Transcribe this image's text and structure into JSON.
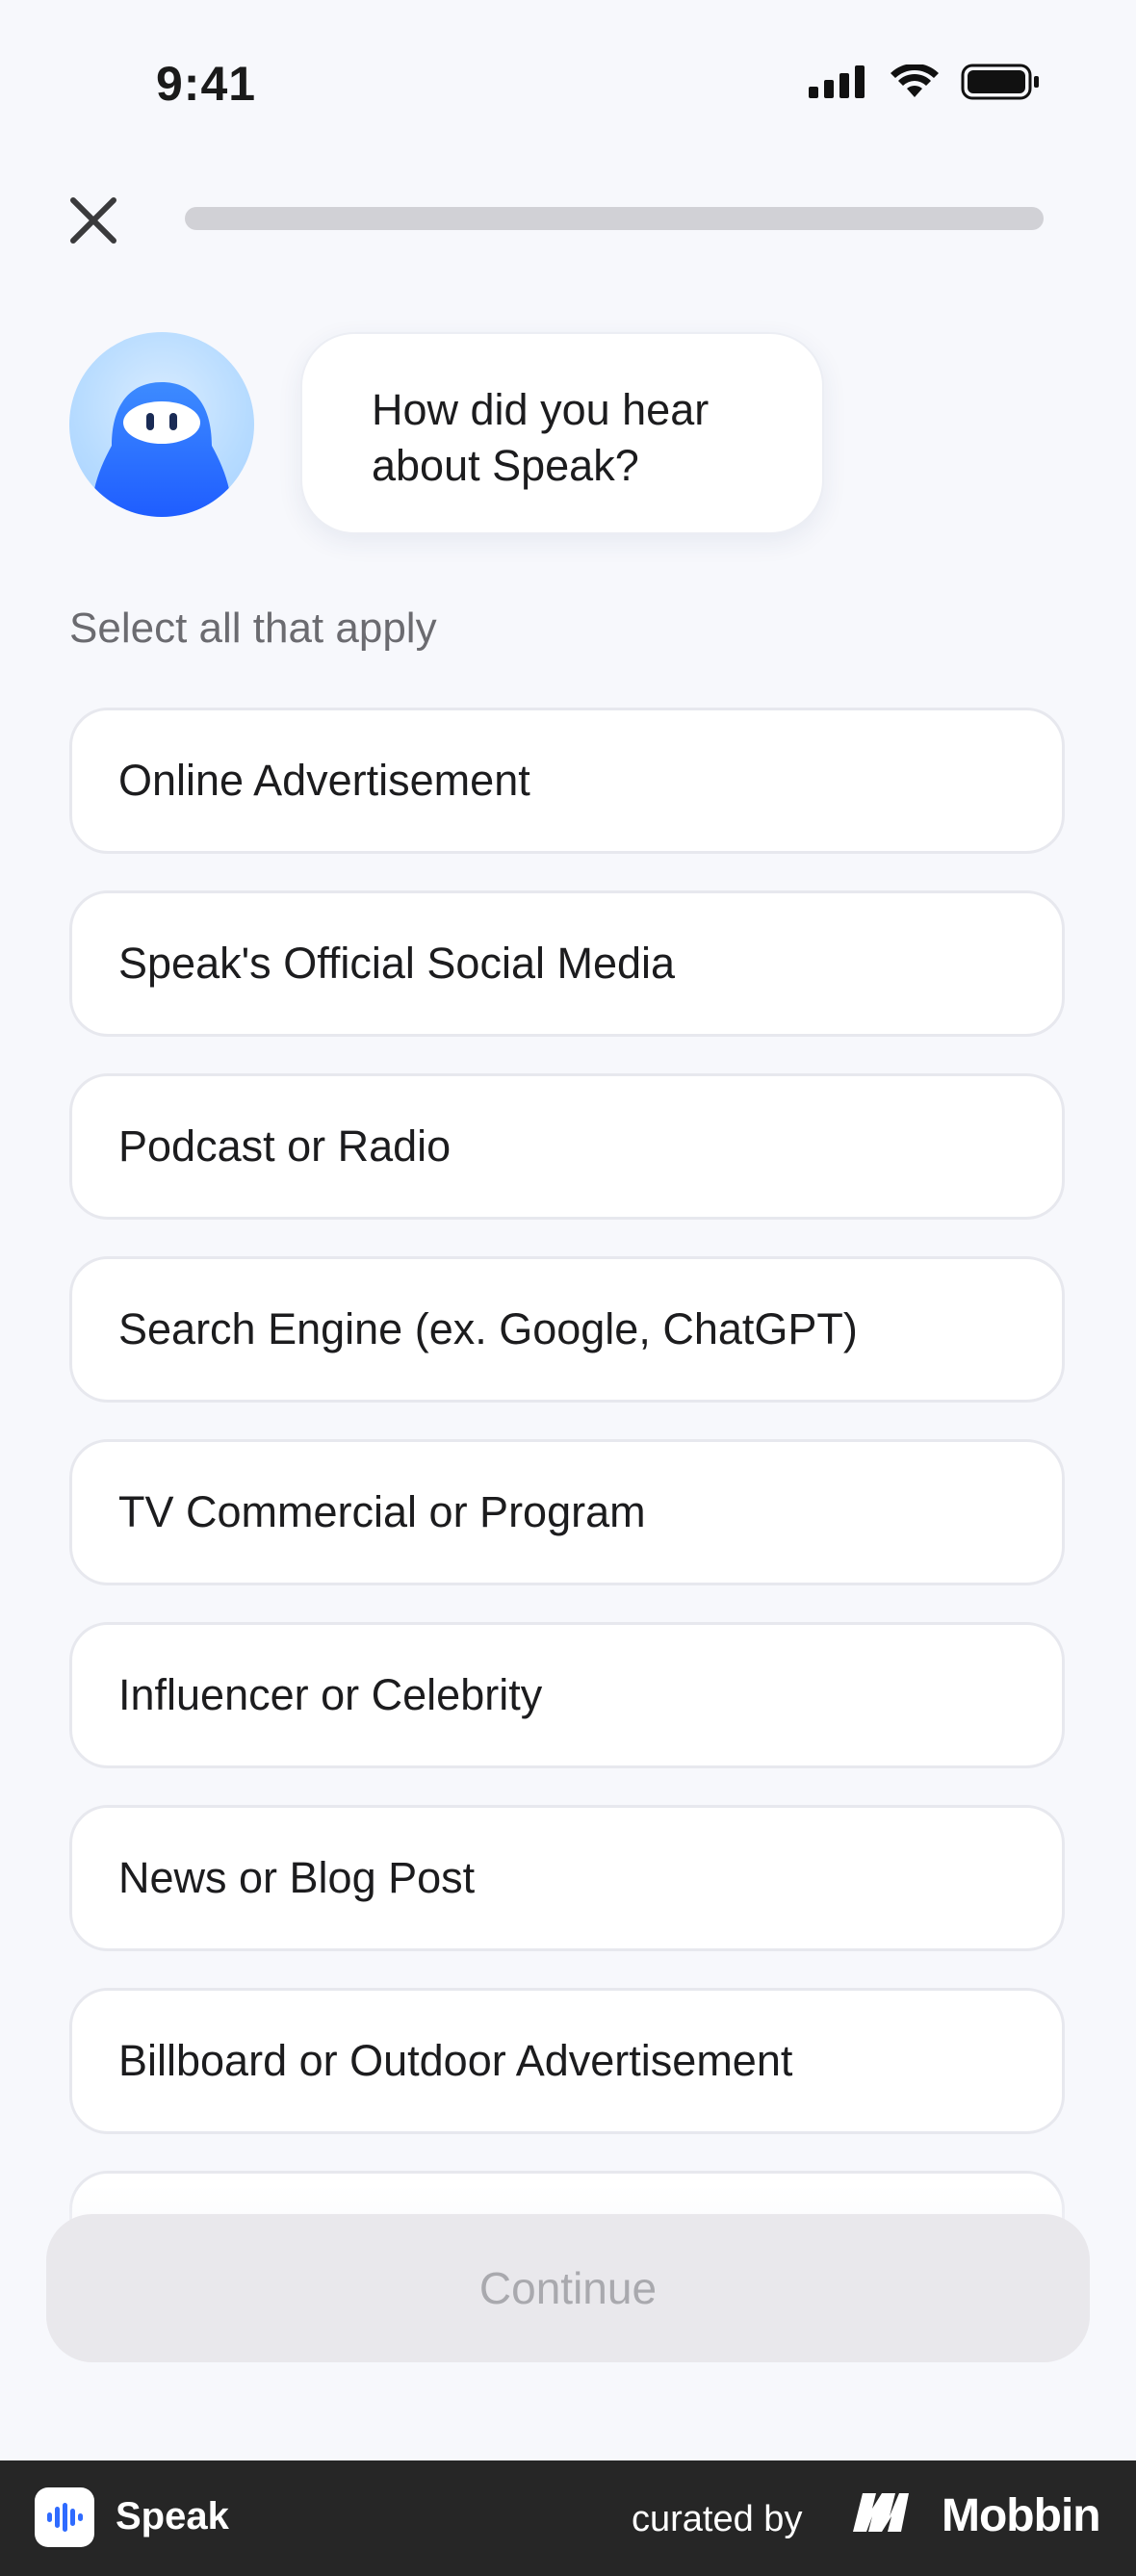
{
  "status_bar": {
    "time": "9:41",
    "icons": [
      "cellular-signal-icon",
      "wifi-icon",
      "battery-icon"
    ]
  },
  "top_bar": {
    "close_icon": "close-icon",
    "progress_fraction": 0
  },
  "prompt": {
    "question": "How did you hear about Speak?",
    "avatar_icon": "speak-mascot-icon"
  },
  "hint": "Select all that apply",
  "options": [
    {
      "label": "Online Advertisement"
    },
    {
      "label": "Speak's Official Social Media"
    },
    {
      "label": "Podcast or Radio"
    },
    {
      "label": "Search Engine (ex. Google, ChatGPT)"
    },
    {
      "label": "TV Commercial or Program"
    },
    {
      "label": "Influencer or Celebrity"
    },
    {
      "label": "News or Blog Post"
    },
    {
      "label": "Billboard or Outdoor Advertisement"
    }
  ],
  "continue_label": "Continue",
  "footer": {
    "app_name": "Speak",
    "curated_by": "curated by",
    "brand": "Mobbin"
  },
  "colors": {
    "background": "#f7f8fc",
    "accent": "#2f6bff",
    "button_disabled_bg": "#e9e8ec",
    "button_disabled_text": "#a9a9ae",
    "footer_bg": "#262626"
  }
}
